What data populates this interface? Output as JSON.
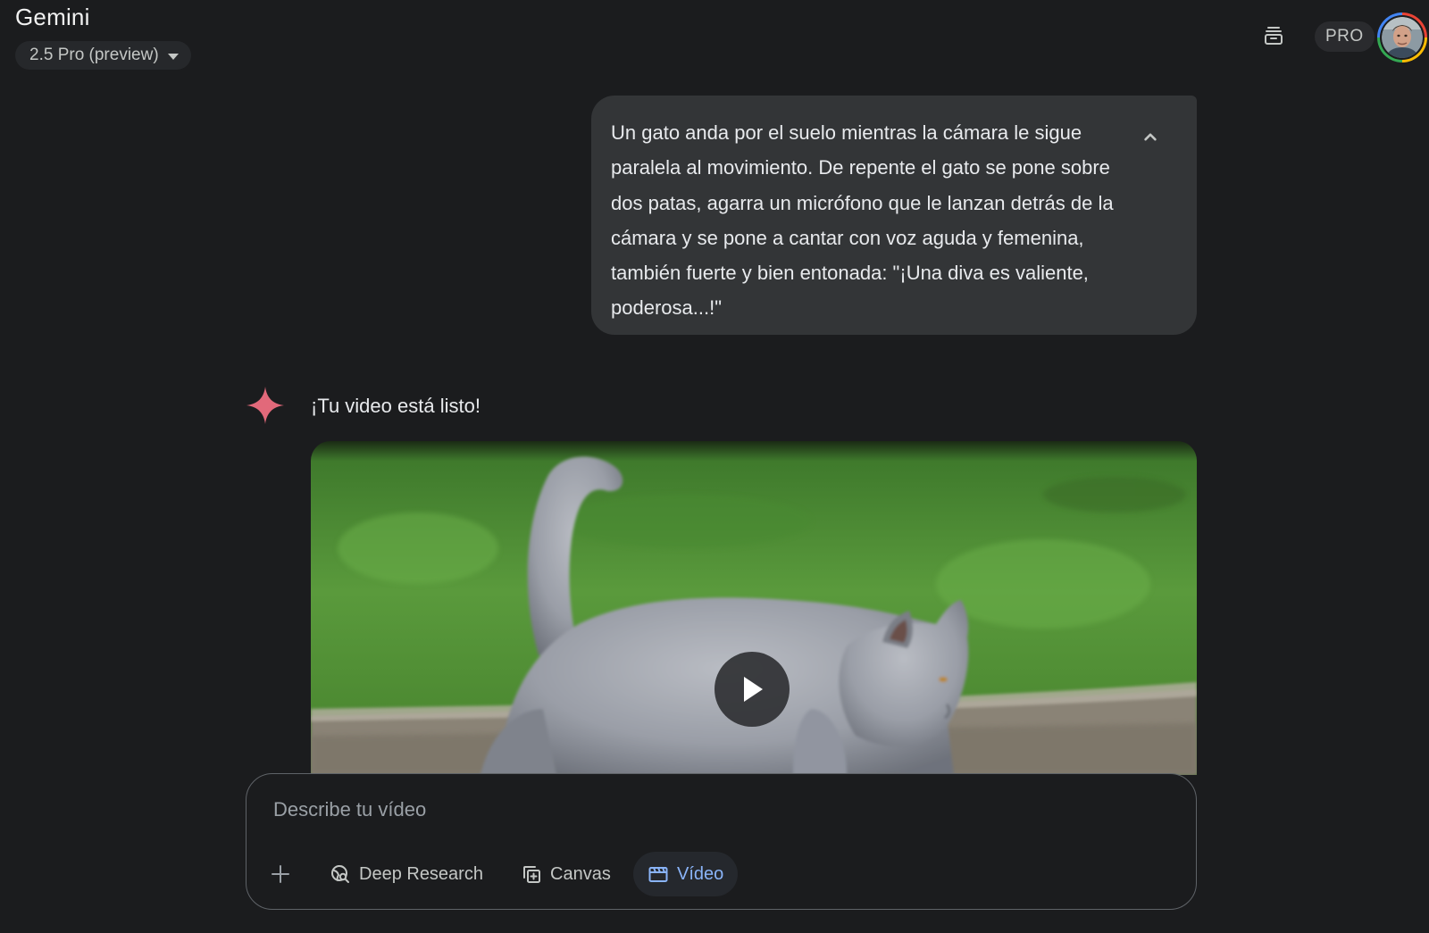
{
  "header": {
    "app_title": "Gemini",
    "model_label": "2.5 Pro (preview)",
    "pro_badge": "PRO"
  },
  "conversation": {
    "user_prompt": "Un gato anda por el suelo mientras la cámara le sigue paralela al movimiento. De repente el gato se pone sobre dos patas, agarra un micrófono que le lanzan detrás de la cámara y se pone a cantar con voz aguda y femenina, también fuerte y bien entonada: \"¡Una diva es valiente, poderosa...!\"",
    "response_text": "¡Tu video está listo!"
  },
  "composer": {
    "placeholder": "Describe tu vídeo",
    "tools": {
      "deep_research": "Deep Research",
      "canvas": "Canvas",
      "video": "Vídeo"
    },
    "active_tool": "video"
  },
  "colors": {
    "background": "#1b1c1e",
    "bubble": "#333537",
    "accent": "#8ab4f8",
    "spark": "#e2697a"
  },
  "icons": {
    "header_action": "archive-icon",
    "collapse": "chevron-up-icon",
    "response": "gemini-spark-icon",
    "play": "play-icon",
    "add": "plus-icon",
    "deep_research": "globe-search-icon",
    "canvas": "canvas-icon",
    "video": "clapperboard-icon"
  }
}
